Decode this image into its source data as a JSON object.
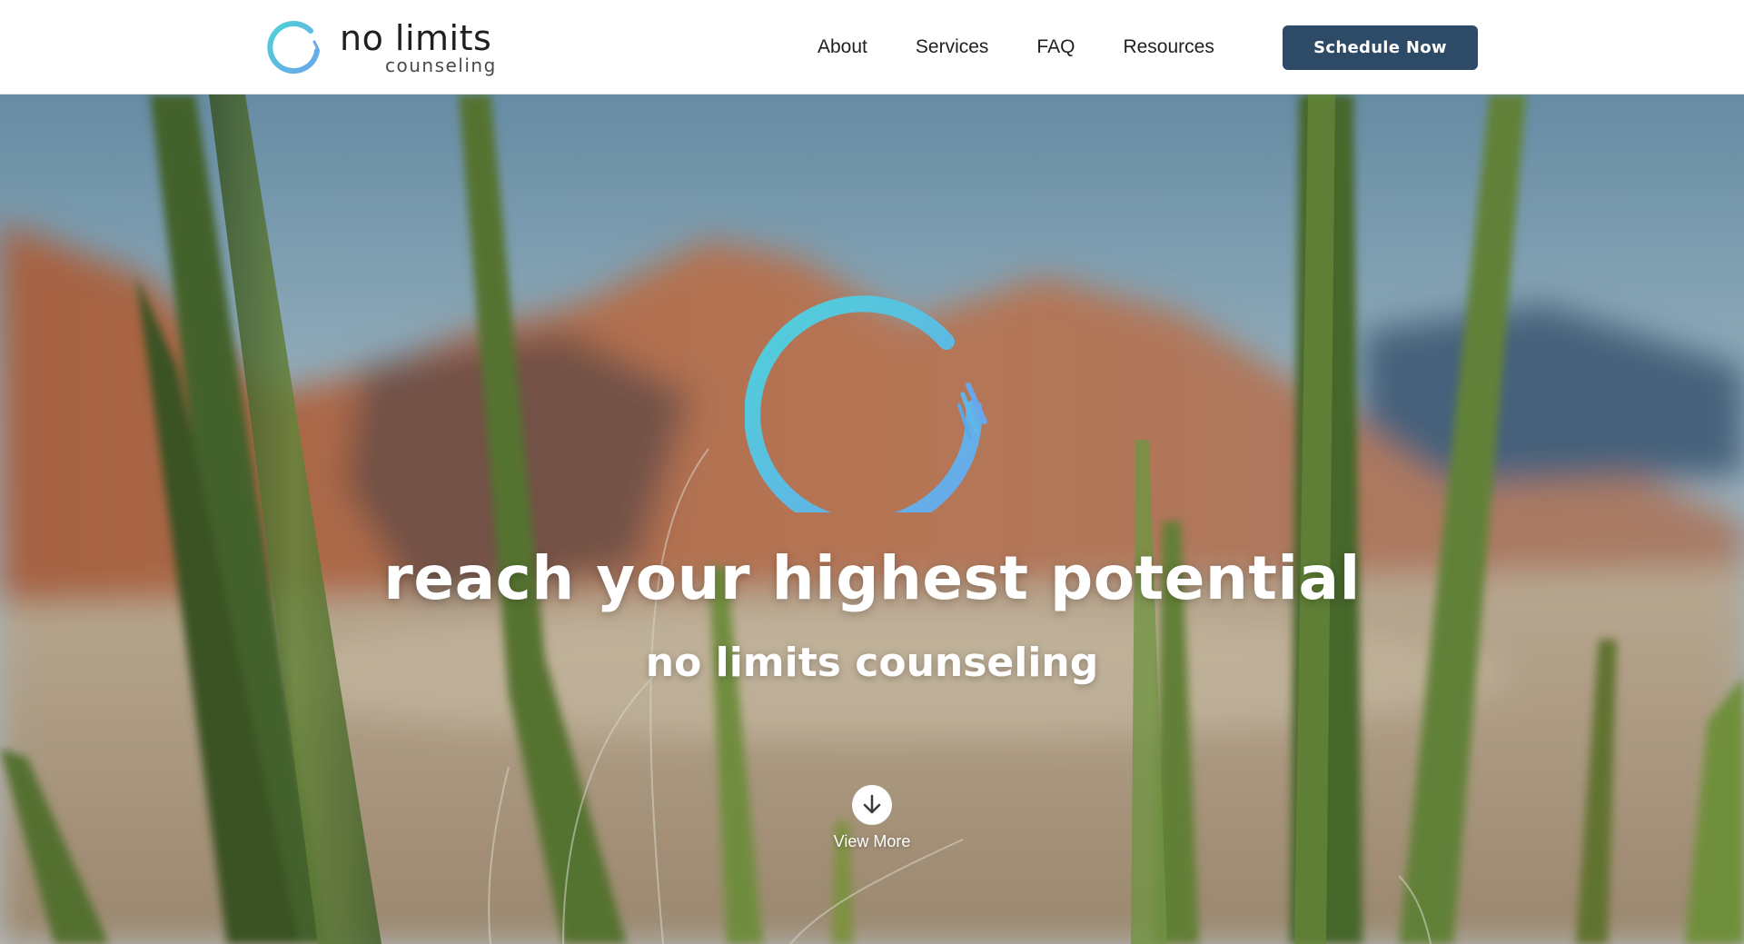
{
  "brand": {
    "name": "no limits",
    "sub": "counseling",
    "logo_icon": "brush-circle-icon"
  },
  "nav": {
    "items": [
      {
        "label": "About"
      },
      {
        "label": "Services"
      },
      {
        "label": "FAQ"
      },
      {
        "label": "Resources"
      }
    ],
    "cta_label": "Schedule Now"
  },
  "hero": {
    "headline": "reach your highest potential",
    "subhead": "no limits counseling",
    "view_more_label": "View More",
    "view_more_icon": "arrow-down-icon",
    "logo_icon": "brush-circle-icon"
  },
  "colors": {
    "brand_teal": "#4fd1d9",
    "brand_blue": "#5aa8ea",
    "cta_bg": "#2d4a67",
    "text_dark": "#1f1f1f"
  }
}
